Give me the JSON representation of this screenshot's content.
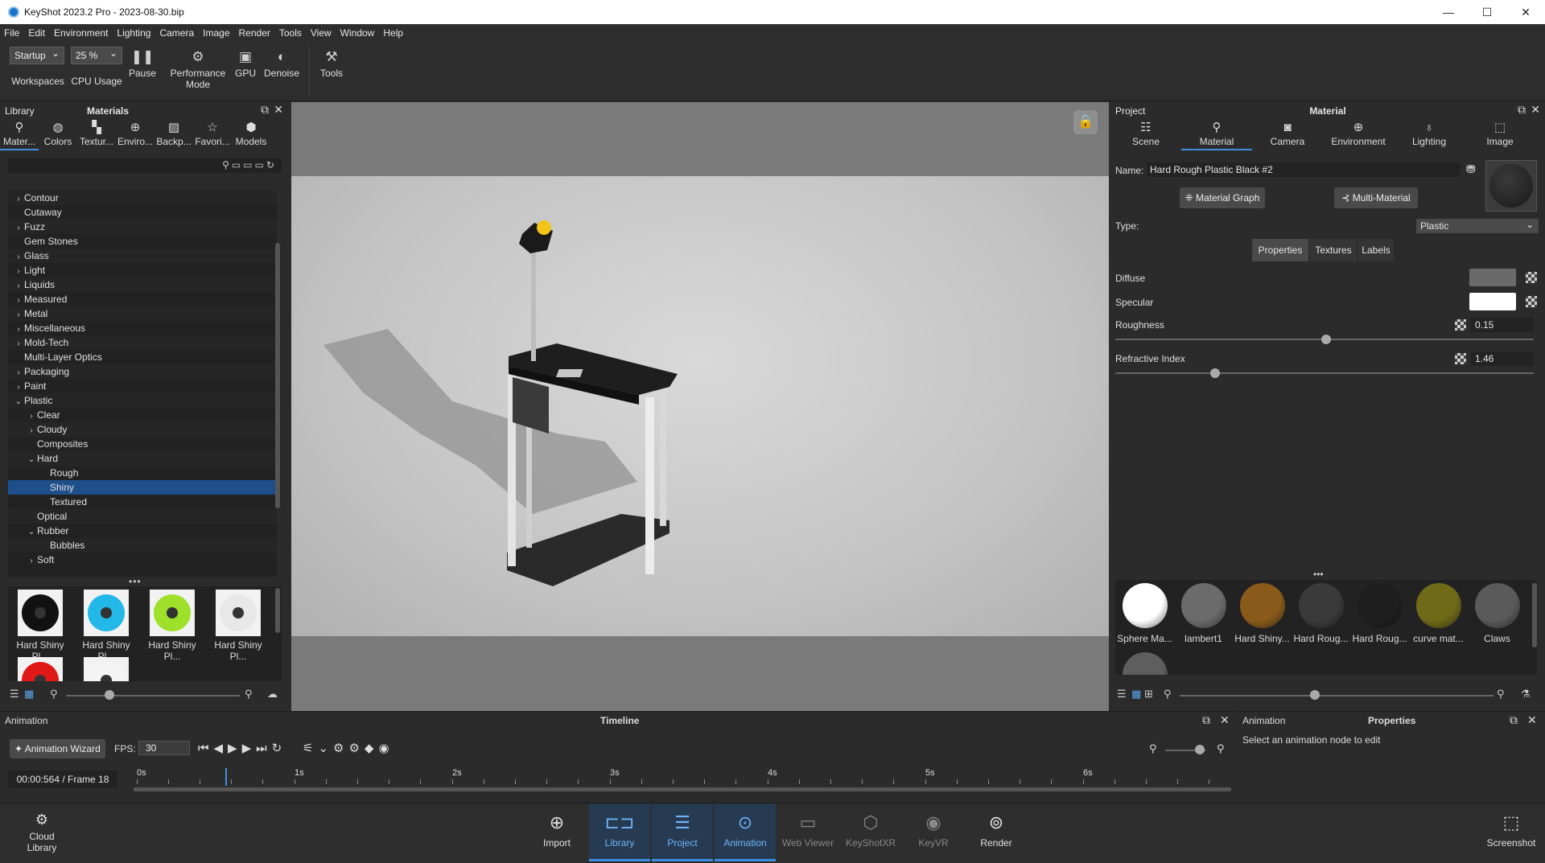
{
  "window": {
    "title": "KeyShot 2023.2 Pro  -  2023-08-30.bip",
    "minimize": "—",
    "maximize": "☐",
    "close": "✕"
  },
  "menu": [
    "File",
    "Edit",
    "Environment",
    "Lighting",
    "Camera",
    "Image",
    "Render",
    "Tools",
    "View",
    "Window",
    "Help"
  ],
  "toolbar": {
    "workspace_value": "Startup",
    "workspace_label": "Workspaces",
    "cpu_value": "25 %",
    "cpu_label": "CPU Usage",
    "pause_label": "Pause",
    "performance_label_1": "Performance",
    "performance_label_2": "Mode",
    "gpu_label": "GPU",
    "denoise_label": "Denoise",
    "tools_label": "Tools"
  },
  "library": {
    "header_left": "Library",
    "header_center": "Materials",
    "tabs": [
      "Mater...",
      "Colors",
      "Textur...",
      "Enviro...",
      "Backp...",
      "Favori...",
      "Models"
    ],
    "tree": [
      {
        "label": "Contour",
        "level": 0,
        "chev": "›"
      },
      {
        "label": "Cutaway",
        "level": 0,
        "chev": ""
      },
      {
        "label": "Fuzz",
        "level": 0,
        "chev": "›"
      },
      {
        "label": "Gem Stones",
        "level": 0,
        "chev": ""
      },
      {
        "label": "Glass",
        "level": 0,
        "chev": "›"
      },
      {
        "label": "Light",
        "level": 0,
        "chev": "›"
      },
      {
        "label": "Liquids",
        "level": 0,
        "chev": "›"
      },
      {
        "label": "Measured",
        "level": 0,
        "chev": "›"
      },
      {
        "label": "Metal",
        "level": 0,
        "chev": "›"
      },
      {
        "label": "Miscellaneous",
        "level": 0,
        "chev": "›"
      },
      {
        "label": "Mold-Tech",
        "level": 0,
        "chev": "›"
      },
      {
        "label": "Multi-Layer Optics",
        "level": 0,
        "chev": ""
      },
      {
        "label": "Packaging",
        "level": 0,
        "chev": "›"
      },
      {
        "label": "Paint",
        "level": 0,
        "chev": "›"
      },
      {
        "label": "Plastic",
        "level": 0,
        "chev": "⌄"
      },
      {
        "label": "Clear",
        "level": 1,
        "chev": "›"
      },
      {
        "label": "Cloudy",
        "level": 1,
        "chev": "›"
      },
      {
        "label": "Composites",
        "level": 1,
        "chev": ""
      },
      {
        "label": "Hard",
        "level": 1,
        "chev": "⌄"
      },
      {
        "label": "Rough",
        "level": 2,
        "chev": ""
      },
      {
        "label": "Shiny",
        "level": 2,
        "chev": "",
        "selected": true
      },
      {
        "label": "Textured",
        "level": 2,
        "chev": ""
      },
      {
        "label": "Optical",
        "level": 1,
        "chev": ""
      },
      {
        "label": "Rubber",
        "level": 1,
        "chev": "⌄"
      },
      {
        "label": "Bubbles",
        "level": 2,
        "chev": ""
      },
      {
        "label": "Soft",
        "level": 1,
        "chev": "›"
      }
    ],
    "thumbnails": [
      {
        "label": "Hard Shiny Pl...",
        "color": "#111111"
      },
      {
        "label": "Hard Shiny Pl...",
        "color": "#22b8e8"
      },
      {
        "label": "Hard Shiny Pl...",
        "color": "#9ee02a"
      },
      {
        "label": "Hard Shiny Pl...",
        "color": "#e8e8e8"
      },
      {
        "label": "",
        "color": "#e01818"
      },
      {
        "label": "",
        "color": "#f4f4f4"
      }
    ],
    "dots": "•••"
  },
  "project": {
    "header_left": "Project",
    "header_center": "Material",
    "tabs": [
      "Scene",
      "Material",
      "Camera",
      "Environment",
      "Lighting",
      "Image"
    ],
    "name_label": "Name:",
    "name_value": "Hard Rough Plastic Black #2",
    "material_graph": "Material Graph",
    "multi_material": "Multi-Material",
    "type_label": "Type:",
    "type_value": "Plastic",
    "segments": [
      "Properties",
      "Textures",
      "Labels"
    ],
    "diffuse_label": "Diffuse",
    "diffuse_color": "#6a6a6a",
    "specular_label": "Specular",
    "specular_color": "#ffffff",
    "roughness_label": "Roughness",
    "roughness_value": "0.15",
    "refractive_label": "Refractive Index",
    "refractive_value": "1.46",
    "dots": "•••",
    "materials": [
      {
        "label": "Sphere Ma...",
        "color": "#ffffff"
      },
      {
        "label": "lambert1",
        "color": "#6b6b6b"
      },
      {
        "label": "Hard Shiny...",
        "color": "#8a5a1a"
      },
      {
        "label": "Hard Roug...",
        "color": "#3a3a3a"
      },
      {
        "label": "Hard Roug...",
        "color": "#1e1e1e"
      },
      {
        "label": "curve mat...",
        "color": "#6f6a18"
      },
      {
        "label": "Claws",
        "color": "#5a5a5a"
      },
      {
        "label": "",
        "color": "#5e5e5e"
      }
    ]
  },
  "animation": {
    "header_left": "Animation",
    "header_center": "Timeline",
    "wizard": "Animation Wizard",
    "fps_label": "FPS:",
    "fps_value": "30",
    "timecode": "00:00:564 / Frame 18",
    "ticks": [
      "0s",
      "1s",
      "2s",
      "3s",
      "4s",
      "5s",
      "6s"
    ],
    "props_left": "Animation",
    "props_center": "Properties",
    "props_hint": "Select an animation node to edit"
  },
  "dock": {
    "cloud_library_1": "Cloud",
    "cloud_library_2": "Library",
    "items": [
      "Import",
      "Library",
      "Project",
      "Animation",
      "Web Viewer",
      "KeyShotXR",
      "KeyVR",
      "Render"
    ],
    "screenshot": "Screenshot"
  }
}
